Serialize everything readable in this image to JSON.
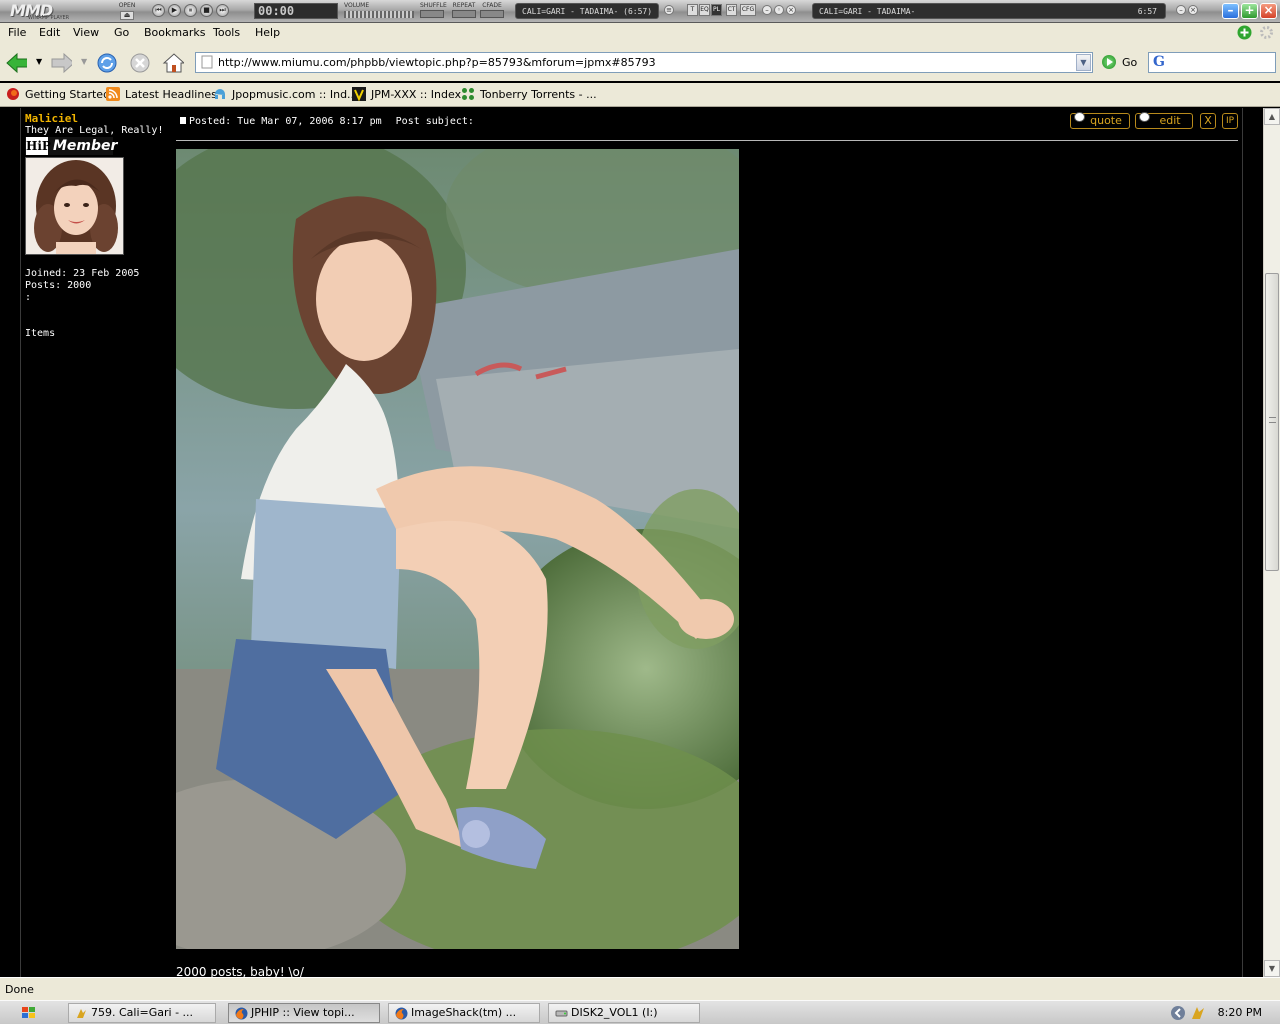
{
  "winamp": {
    "logo": "MMD",
    "logo_sub": "WINAMP PLAYER",
    "open_label": "OPEN",
    "time": "00:00",
    "volume_label": "VOLUME",
    "shuffle_label": "SHUFFLE",
    "repeat_label": "REPEAT",
    "cfade_label": "CFADE",
    "track_left": "CALI=GARI - TADAIMA- (6:57)",
    "track_right": "CALI=GARI - TADAIMA-",
    "track_time": "6:57",
    "mode_buttons": [
      "T",
      "EQ",
      "PL",
      "CT",
      "CFG"
    ]
  },
  "menu": {
    "items": [
      "File",
      "Edit",
      "View",
      "Go",
      "Bookmarks",
      "Tools",
      "Help"
    ]
  },
  "nav": {
    "url": "http://www.miumu.com/phpbb/viewtopic.php?p=85793&mforum=jpmx#85793",
    "go_label": "Go",
    "search_logo": "G"
  },
  "bookmarks": [
    {
      "label": "Getting Started",
      "icon": "firefox-icon"
    },
    {
      "label": "Latest Headlines",
      "icon": "rss-icon"
    },
    {
      "label": "Jpopmusic.com :: Ind...",
      "icon": "jpopmusic-icon"
    },
    {
      "label": "JPM-XXX :: Index",
      "icon": "jpm-icon"
    },
    {
      "label": "Tonberry Torrents - ...",
      "icon": "tonberry-icon"
    }
  ],
  "post": {
    "username": "Maliciel",
    "user_title": "They Are Legal, Really!",
    "rank_hip": "HiP",
    "rank_member": "Member",
    "joined": "Joined: 23 Feb 2005",
    "posts": "Posts: 2000",
    "extra": ":",
    "items": "Items",
    "posted": "Posted: Tue Mar 07, 2006 8:17 pm",
    "subject": "Post subject:",
    "buttons": {
      "quote": "quote",
      "edit": "edit",
      "delete": "X",
      "ip": "IP"
    },
    "body": "2000 posts, baby! \\o/"
  },
  "status": {
    "text": "Done"
  },
  "taskbar": {
    "buttons": [
      {
        "label": "759. Cali=Gari - ...",
        "icon": "winamp-icon",
        "active": false
      },
      {
        "label": "JPHIP :: View topi...",
        "icon": "firefox-icon",
        "active": true
      },
      {
        "label": "ImageShack(tm) ...",
        "icon": "firefox-icon",
        "active": false
      },
      {
        "label": "DISK2_VOL1 (I:)",
        "icon": "drive-icon",
        "active": false
      }
    ],
    "clock": "8:20 PM"
  },
  "colors": {
    "username": "#f0b400",
    "post_button": "#d9a520",
    "xp_chrome": "#ece9d8"
  }
}
